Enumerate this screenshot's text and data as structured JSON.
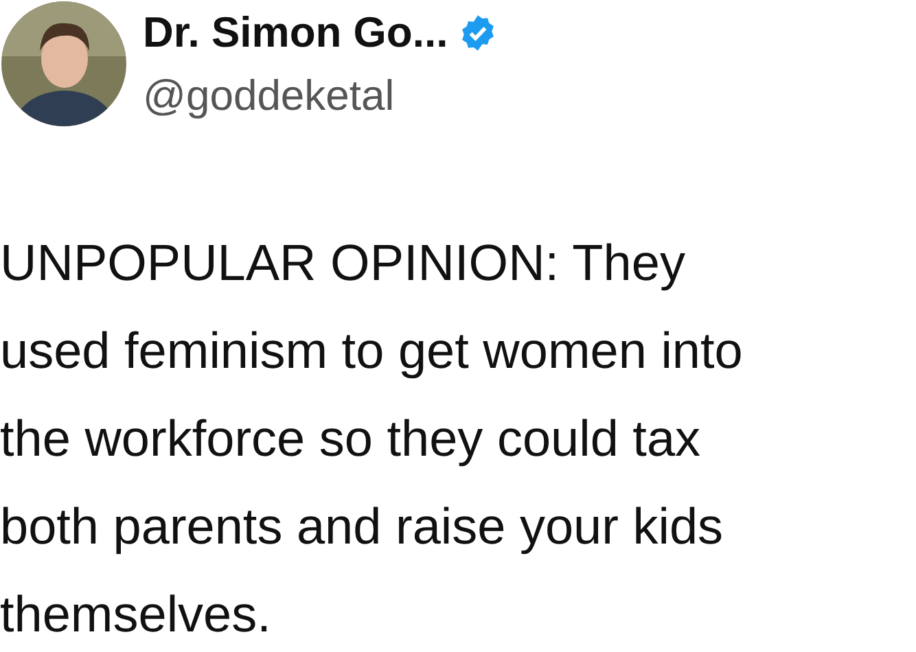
{
  "author": {
    "name": "Dr. Simon Go...",
    "verified": true,
    "handle": "@goddeketal"
  },
  "tweet": {
    "lines": [
      "UNPOPULAR OPINION: They",
      "used feminism to get women into",
      "the workforce so they could tax",
      "both parents and raise your kids",
      "themselves."
    ]
  }
}
